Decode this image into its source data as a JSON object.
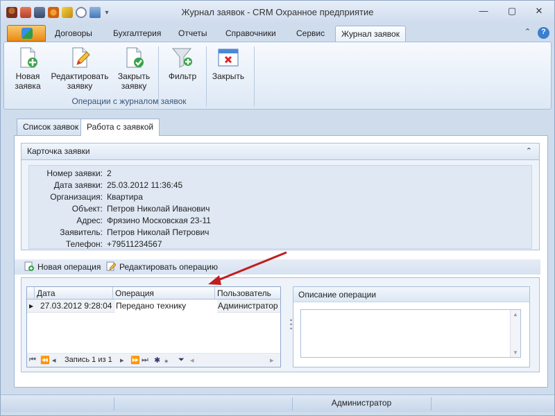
{
  "window": {
    "title": "Журнал заявок - CRM Охранное предприятие"
  },
  "ribbon_tabs": [
    "Договоры",
    "Бухгалтерия",
    "Отчеты",
    "Справочники",
    "Сервис",
    "Журнал заявок"
  ],
  "ribbon": {
    "new_line1": "Новая",
    "new_line2": "заявка",
    "edit_line1": "Редактировать",
    "edit_line2": "заявку",
    "close_req_line1": "Закрыть",
    "close_req_line2": "заявку",
    "filter": "Фильтр",
    "close": "Закрыть",
    "group_label": "Операции с журналом заявок"
  },
  "panel_tabs": {
    "list": "Список заявок",
    "work": "Работа с заявкой"
  },
  "card": {
    "title": "Карточка заявки",
    "collapse_icon": "chevron-up-icon",
    "fields": [
      {
        "label": "Номер заявки:",
        "value": "2"
      },
      {
        "label": "Дата заявки:",
        "value": "25.03.2012 11:36:45"
      },
      {
        "label": "Организация:",
        "value": "Квартира"
      },
      {
        "label": "Объект:",
        "value": "Петров Николай Иванович"
      },
      {
        "label": "Адрес:",
        "value": "Фрязино Московская 23-11"
      },
      {
        "label": "Заявитель:",
        "value": "Петров Николай Петрович"
      },
      {
        "label": "Телефон:",
        "value": "+79511234567"
      }
    ]
  },
  "ops_toolbar": {
    "new_op": "Новая операция",
    "edit_op": "Редактировать операцию"
  },
  "grid": {
    "columns": [
      "Дата",
      "Операция",
      "Пользователь"
    ],
    "rows": [
      {
        "date": "27.03.2012 9:28:04",
        "operation": "Передано технику",
        "user": "Администратор"
      }
    ],
    "record_text": "Запись 1 из 1"
  },
  "description": {
    "title": "Описание операции"
  },
  "status": {
    "user": "Администратор"
  },
  "colors": {
    "accent": "#e98a14",
    "frame": "#a5bcda",
    "arrow": "#c11d1d"
  }
}
